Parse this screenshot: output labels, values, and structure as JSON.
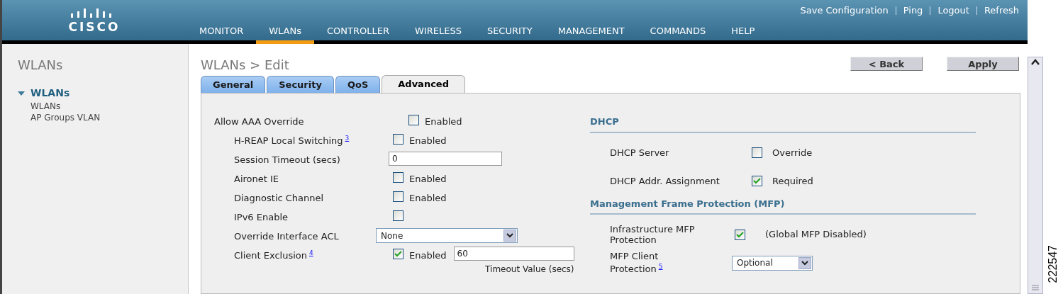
{
  "header": {
    "logo_text": "CISCO",
    "top_links": [
      "Save Configuration",
      "Ping",
      "Logout",
      "Refresh"
    ],
    "menu": [
      {
        "label": "MONITOR",
        "selected": false
      },
      {
        "label": "WLANs",
        "selected": true
      },
      {
        "label": "CONTROLLER",
        "selected": false
      },
      {
        "label": "WIRELESS",
        "selected": false
      },
      {
        "label": "SECURITY",
        "selected": false
      },
      {
        "label": "MANAGEMENT",
        "selected": false
      },
      {
        "label": "COMMANDS",
        "selected": false
      },
      {
        "label": "HELP",
        "selected": false
      }
    ]
  },
  "sidebar": {
    "title": "WLANs",
    "tree": [
      {
        "label": "WLANs",
        "expanded": true,
        "children": [
          {
            "label": "WLANs"
          },
          {
            "label": "AP Groups VLAN"
          }
        ]
      }
    ]
  },
  "page_title": "WLANs > Edit",
  "buttons": [
    "< Back",
    "Apply"
  ],
  "tabs": [
    {
      "label": "General",
      "selected": false
    },
    {
      "label": "Security",
      "selected": false
    },
    {
      "label": "QoS",
      "selected": false
    },
    {
      "label": "Advanced",
      "selected": true
    }
  ],
  "left_settings": [
    {
      "kind": "checkbox",
      "label": "Allow AAA Override",
      "checked": false,
      "option": "Enabled",
      "children": [
        {
          "kind": "checkbox",
          "label": "H-REAP Local Switching",
          "footnote": "3",
          "checked": false,
          "option": "Enabled"
        },
        {
          "kind": "text",
          "label": "Session Timeout (secs)",
          "value": "0"
        },
        {
          "kind": "checkbox",
          "label": "Aironet IE",
          "checked": false,
          "option": "Enabled"
        },
        {
          "kind": "checkbox",
          "label": "Diagnostic Channel",
          "checked": false,
          "option": "Enabled"
        },
        {
          "kind": "checkbox",
          "label": "IPv6 Enable",
          "checked": false
        },
        {
          "kind": "select",
          "label": "Override Interface ACL",
          "value": "None"
        },
        {
          "kind": "checkbox_text",
          "label": "Client Exclusion",
          "footnote": "4",
          "checked": true,
          "option": "Enabled",
          "value": "60",
          "sub_label": "Timeout Value (secs)"
        }
      ]
    }
  ],
  "right_sections": [
    {
      "heading": "DHCP",
      "rows": [
        {
          "kind": "checkbox",
          "label": "DHCP Server",
          "checked": false,
          "option": "Override"
        },
        {
          "kind": "checkbox",
          "label": "DHCP Addr. Assignment",
          "checked": true,
          "option": "Required"
        }
      ]
    },
    {
      "heading": "Management Frame Protection (MFP)",
      "rows": [
        {
          "kind": "checkbox",
          "label": "Infrastructure MFP Protection",
          "checked": true,
          "option": "(Global MFP Disabled)"
        },
        {
          "kind": "select",
          "label": "MFP Client Protection",
          "footnote": "5",
          "value": "Optional"
        }
      ]
    }
  ],
  "figure_id": "222547"
}
